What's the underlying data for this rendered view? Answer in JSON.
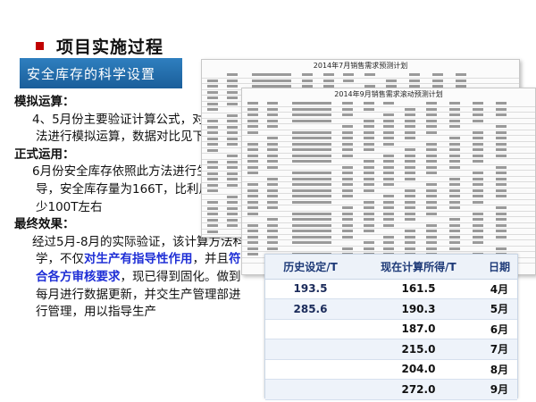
{
  "header": {
    "title": "项目实施过程",
    "section_label": "安全库存的科学设置"
  },
  "body": {
    "simulation_head": "模拟运算：",
    "simulation_text": "4、5月份主要验证计算公式，对计算方法进行模拟运算，数据对比见下表",
    "formal_head": "正式运用：",
    "formal_text": "6月份安全库存依照此方法进行生产指导，安全库存量为166T，比利用经验要少100T左右",
    "result_head": "最终效果：",
    "result_text_1": "经过5月-8月的实际验证，该计算方法科学，不仅",
    "result_blue_1": "对生产有指导性作用",
    "result_text_2": "，并且",
    "result_blue_2": "符合各方审核要求",
    "result_text_3": "，现已得到固化。做到每月进行数据更新，并交生产管理部进行管理，用以指导生产"
  },
  "sheets": {
    "back_title": "2014年7月销售需求预测计划",
    "front_title": "2014年9月销售需求滚动预测计划"
  },
  "table": {
    "headers": [
      "历史设定/T",
      "现在计算所得/T",
      "日期"
    ],
    "rows": [
      [
        "193.5",
        "161.5",
        "4月"
      ],
      [
        "285.6",
        "190.3",
        "5月"
      ],
      [
        "",
        "187.0",
        "6月"
      ],
      [
        "",
        "215.0",
        "7月"
      ],
      [
        "",
        "204.0",
        "8月"
      ],
      [
        "",
        "272.0",
        "9月"
      ]
    ]
  }
}
